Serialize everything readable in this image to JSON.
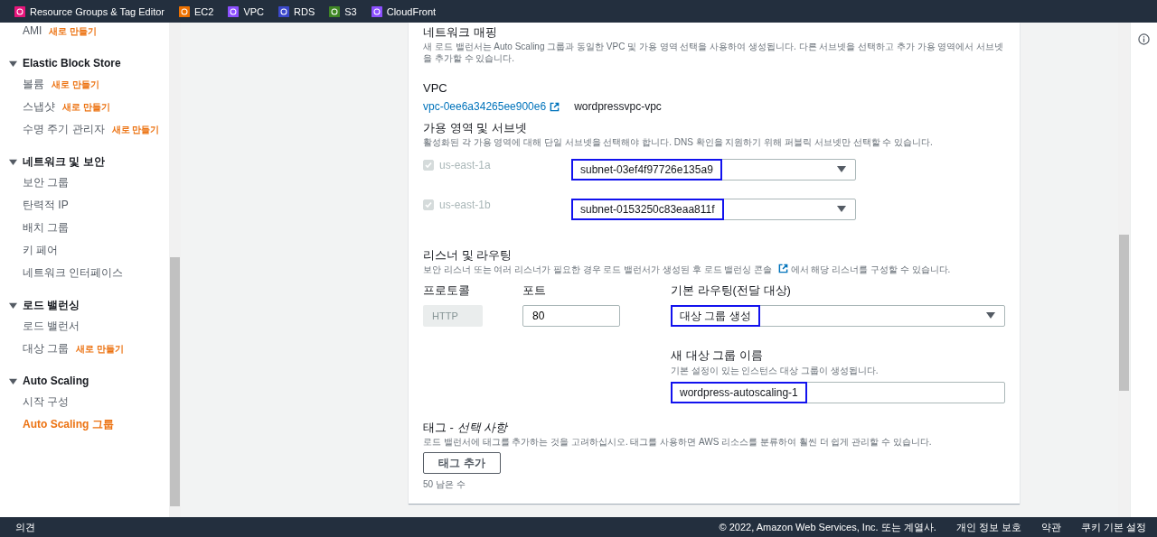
{
  "service_bar": [
    {
      "label": "Resource Groups & Tag Editor",
      "color": "#e7157b"
    },
    {
      "label": "EC2",
      "color": "#ed7100"
    },
    {
      "label": "VPC",
      "color": "#8c4fff"
    },
    {
      "label": "RDS",
      "color": "#3b48cc"
    },
    {
      "label": "S3",
      "color": "#3f8624"
    },
    {
      "label": "CloudFront",
      "color": "#8c4fff"
    }
  ],
  "sidebar": {
    "sections": [
      {
        "items": [
          {
            "label": "AMI",
            "badge": "새로 만들기",
            "selected": false
          }
        ]
      },
      {
        "title": "Elastic Block Store",
        "expanded": true,
        "items": [
          {
            "label": "볼륨",
            "badge": "새로 만들기",
            "selected": false
          },
          {
            "label": "스냅샷",
            "badge": "새로 만들기",
            "selected": false
          },
          {
            "label": "수명 주기 관리자",
            "badge": "새로 만들기",
            "selected": false
          }
        ]
      },
      {
        "title": "네트워크 및 보안",
        "expanded": true,
        "items": [
          {
            "label": "보안 그룹",
            "selected": false
          },
          {
            "label": "탄력적 IP",
            "selected": false
          },
          {
            "label": "배치 그룹",
            "selected": false
          },
          {
            "label": "키 페어",
            "selected": false
          },
          {
            "label": "네트워크 인터페이스",
            "selected": false
          }
        ]
      },
      {
        "title": "로드 밸런싱",
        "expanded": true,
        "items": [
          {
            "label": "로드 밸런서",
            "selected": false
          },
          {
            "label": "대상 그룹",
            "badge": "새로 만들기",
            "selected": false
          }
        ]
      },
      {
        "title": "Auto Scaling",
        "expanded": true,
        "items": [
          {
            "label": "시작 구성",
            "selected": false
          },
          {
            "label": "Auto Scaling 그룹",
            "selected": true
          }
        ]
      }
    ]
  },
  "network_mapping": {
    "title": "네트워크 매핑",
    "description": "새 로드 밸런서는 Auto Scaling 그룹과 동일한 VPC 및 가용 영역 선택을 사용하여 생성됩니다. 다른 서브넷을 선택하고 추가 가용 영역에서 서브넷을 추가할 수 있습니다.",
    "vpc_label": "VPC",
    "vpc_id": "vpc-0ee6a34265ee900e6",
    "vpc_name": "wordpressvpc-vpc",
    "zones_title": "가용 영역 및 서브넷",
    "zones_description": "활성화된 각 가용 영역에 대해 단일 서브넷을 선택해야 합니다. DNS 확인을 지원하기 위해 퍼블릭 서브넷만 선택할 수 있습니다.",
    "zones": [
      {
        "label": "us-east-1a",
        "checked": true,
        "disabled": true,
        "subnet": "subnet-03ef4f97726e135a9",
        "highlighted": true
      },
      {
        "label": "us-east-1b",
        "checked": true,
        "disabled": true,
        "subnet": "subnet-0153250c83eaa811f",
        "highlighted": true
      }
    ]
  },
  "listeners": {
    "title": "리스너 및 라우팅",
    "description_before": "보안 리스너 또는 여러 리스너가 필요한 경우 로드 밸런서가 생성된 후",
    "console_link": "로드 밸런싱 콘솔",
    "description_after": "에서 해당 리스너를 구성할 수 있습니다.",
    "protocol_label": "프로토콜",
    "protocol": "HTTP",
    "port_label": "포트",
    "port": "80",
    "routing_label": "기본 라우팅(전달 대상)",
    "routing": "대상 그룹 생성",
    "routing_highlighted": true,
    "name_label": "새 대상 그룹 이름",
    "name_hint": "기본 설정이 있는 인스턴스 대상 그룹이 생성됩니다.",
    "name_value": "wordpress-autoscaling-1",
    "name_highlighted": true
  },
  "tags": {
    "title": "태그 - *선택 사항*",
    "description": "로드 밸런서에 태그를 추가하는 것을 고려하십시오. 태그를 사용하면 AWS 리소스를 분류하여 훨씬 더 쉽게 관리할 수 있습니다.",
    "button": "태그 추가",
    "remaining": "50 남은 수"
  },
  "footer": {
    "feedback": "의견",
    "copyright": "© 2022, Amazon Web Services, Inc. 또는 계열사.",
    "links": [
      "개인 정보 보호",
      "약관",
      "쿠키 기본 설정"
    ]
  }
}
